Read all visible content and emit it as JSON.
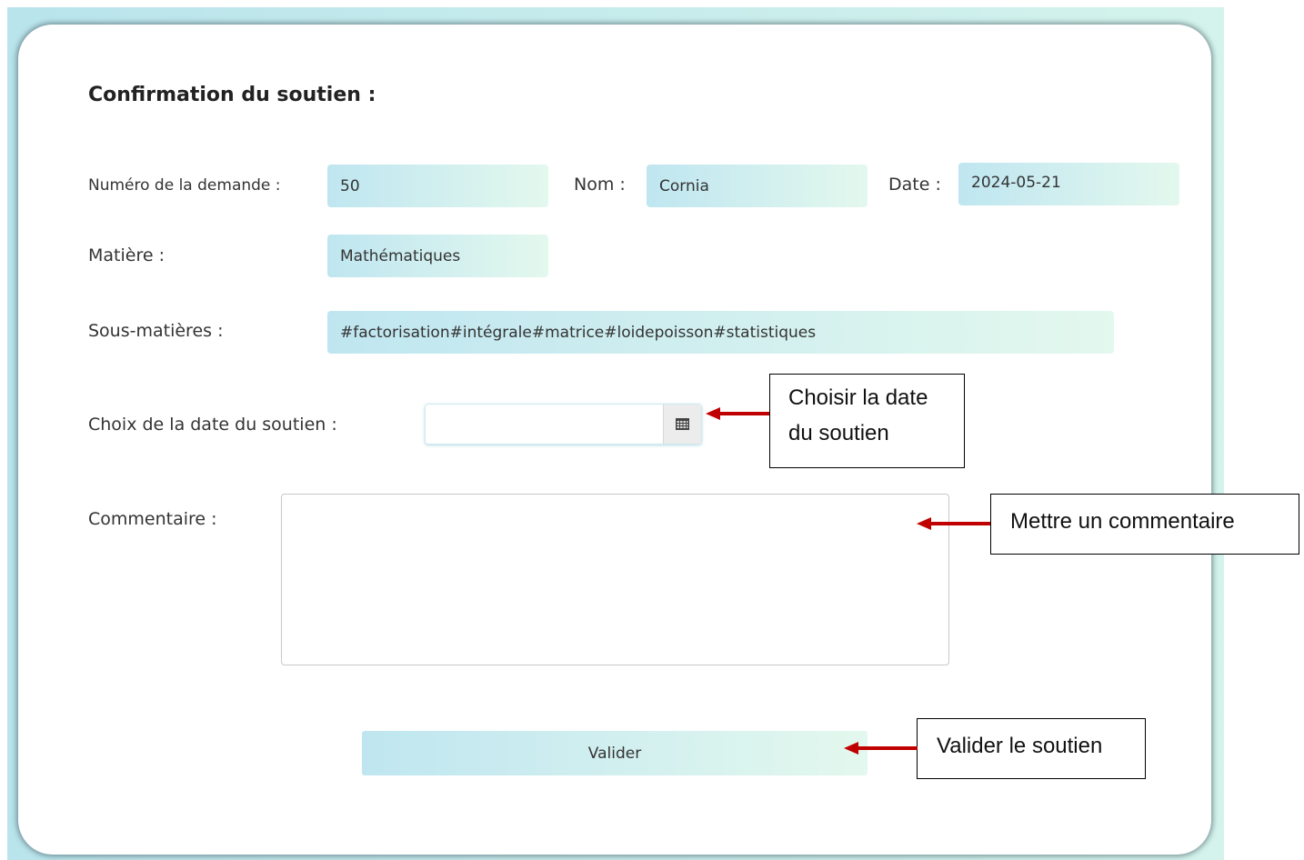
{
  "form": {
    "title": "Confirmation du soutien :",
    "numero_label": "Numéro de la demande :",
    "numero_value": "50",
    "nom_label": "Nom :",
    "nom_value": "Cornia",
    "date_label": "Date :",
    "date_value": "2024-05-21",
    "matiere_label": "Matière :",
    "matiere_value": "Mathématiques",
    "sous_matieres_label": "Sous-matières :",
    "sous_matieres_value": "#factorisation#intégrale#matrice#loidepoisson#statistiques",
    "choix_date_label": "Choix de la date du soutien :",
    "choix_date_value": "",
    "commentaire_label": "Commentaire :",
    "commentaire_value": "",
    "valider_label": "Valider"
  },
  "annotations": {
    "date_callout_line1": "Choisir la date",
    "date_callout_line2": "du soutien",
    "comment_callout": "Mettre un commentaire",
    "validate_callout": "Valider le soutien"
  },
  "colors": {
    "field_gradient_start": "#bfe6f0",
    "field_gradient_end": "#e3f8ee",
    "arrow": "#c00000"
  },
  "icons": {
    "date_picker": "calendar-icon"
  }
}
